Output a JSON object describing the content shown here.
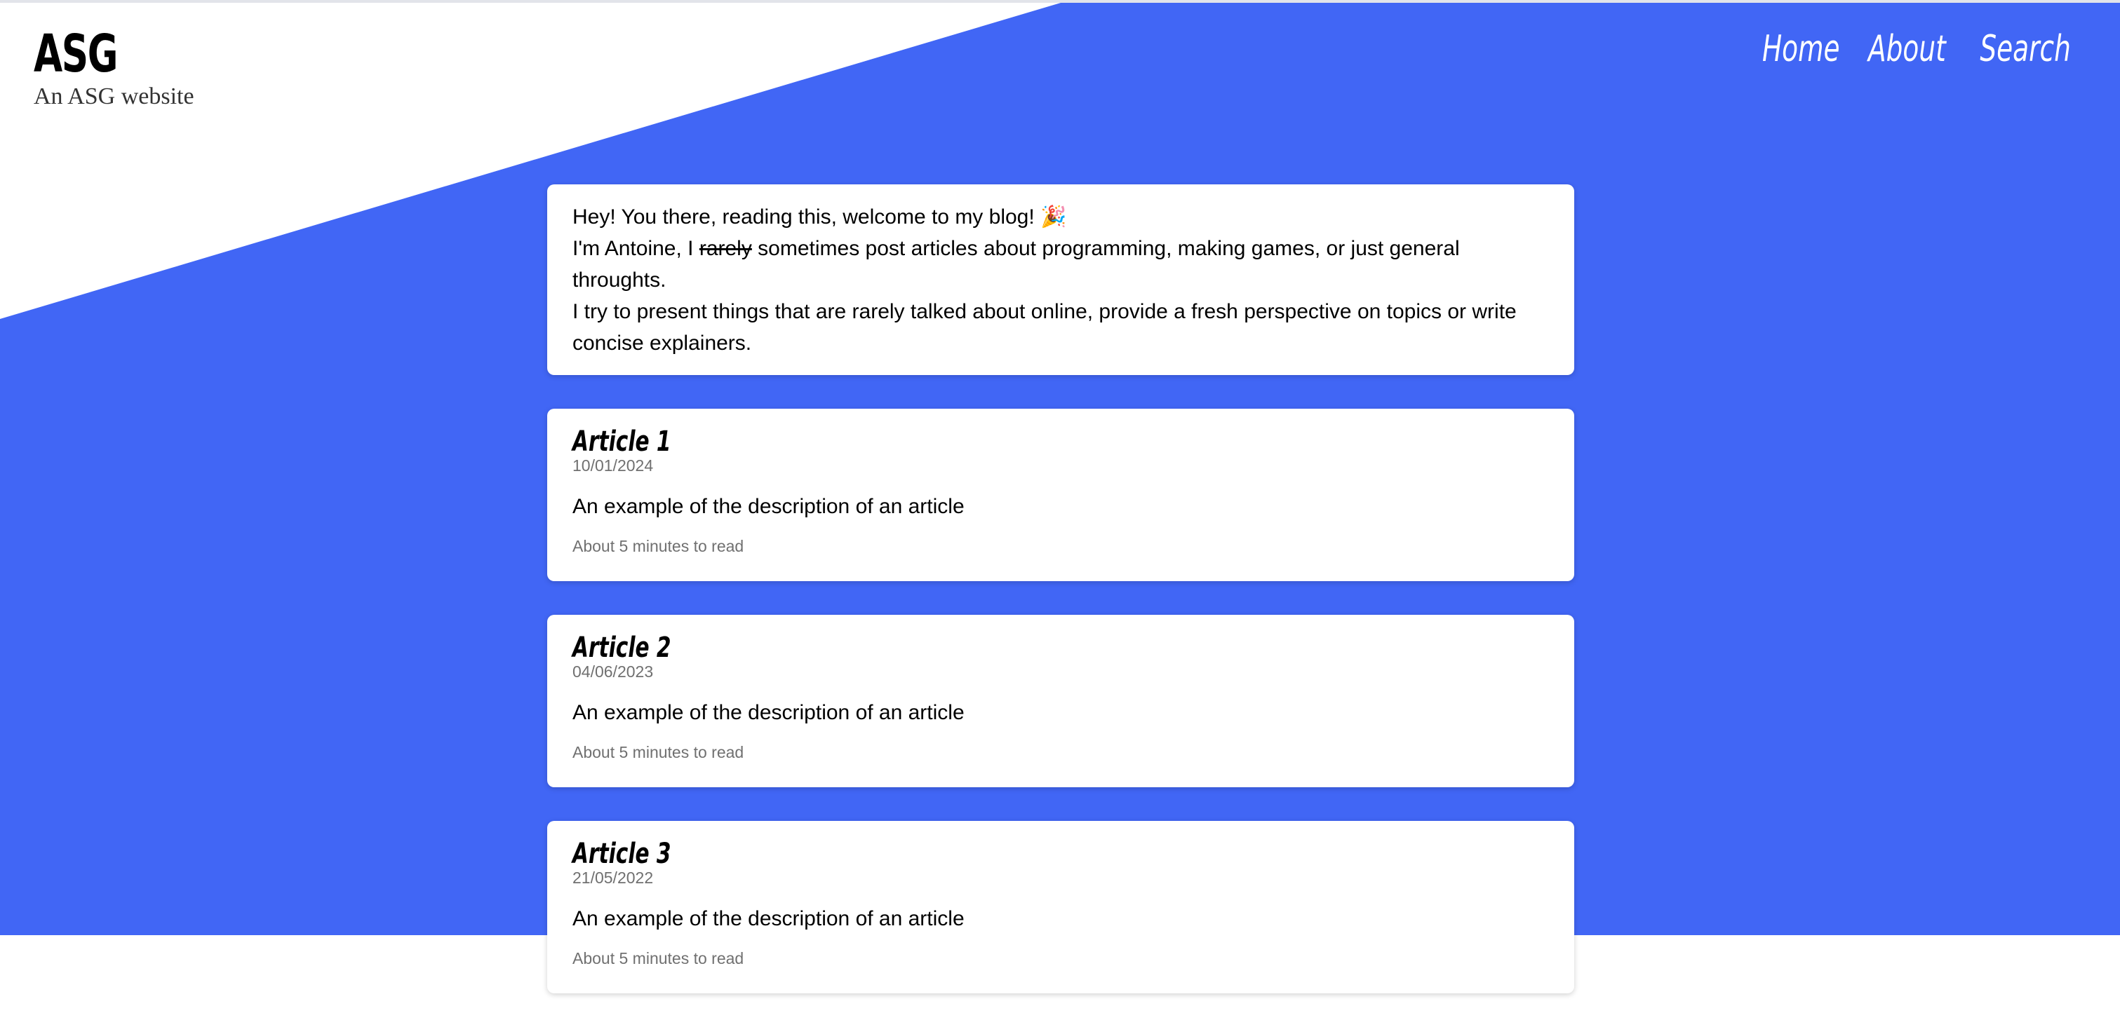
{
  "header": {
    "title": "ASG",
    "subtitle": "An ASG website"
  },
  "nav": {
    "items": [
      "Home",
      "About",
      "Search"
    ]
  },
  "intro": {
    "line1": "Hey! You there, reading this, welcome to my blog!",
    "line1_emoji": "party-popper-icon",
    "line2_prefix": "I'm Antoine, I ",
    "line2_strike": "rarely",
    "line2_suffix": " sometimes post articles about programming, making games, or just general throughts.",
    "line3": "I try to present things that are rarely talked about online, provide a fresh perspective on topics or write concise explainers."
  },
  "articles": [
    {
      "title": "Article 1",
      "date": "10/01/2024",
      "description": "An example of the description of an article",
      "read_time": "About 5 minutes to read"
    },
    {
      "title": "Article 2",
      "date": "04/06/2023",
      "description": "An example of the description of an article",
      "read_time": "About 5 minutes to read"
    },
    {
      "title": "Article 3",
      "date": "21/05/2022",
      "description": "An example of the description of an article",
      "read_time": "About 5 minutes to read"
    }
  ],
  "colors": {
    "accent": "#4166f5",
    "card_bg": "#ffffff",
    "muted_text": "#707070"
  }
}
